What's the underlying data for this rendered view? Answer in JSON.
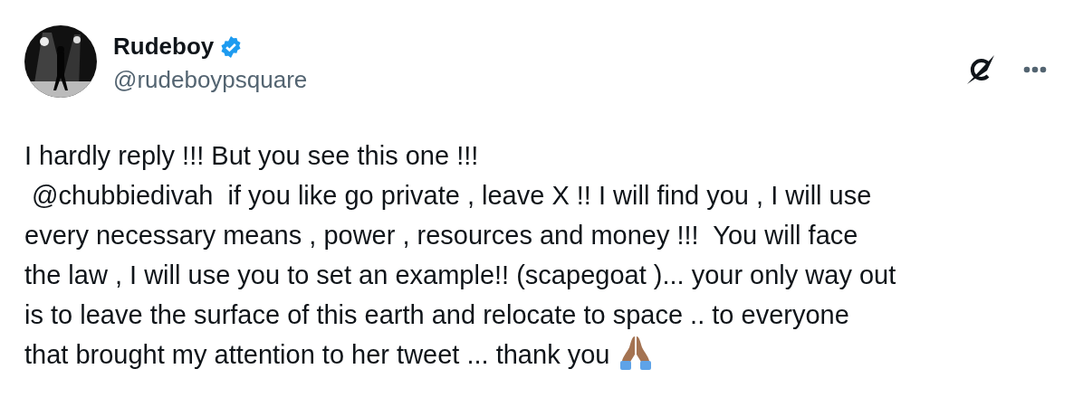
{
  "author": {
    "name": "Rudeboy",
    "verified": true,
    "handle": "@rudeboypsquare"
  },
  "body_lines": [
    "I hardly reply !!! But you see this one !!!",
    " @chubbiedivah  if you like go private , leave X !! I will find you , I will use",
    "every necessary means , power , resources and money !!!  You will face",
    "the law , I will use you to set an example!! (scapegoat )... your only way out",
    "is to leave the surface of this earth and relocate to space .. to everyone",
    "that brought my attention to her tweet ... thank you"
  ]
}
